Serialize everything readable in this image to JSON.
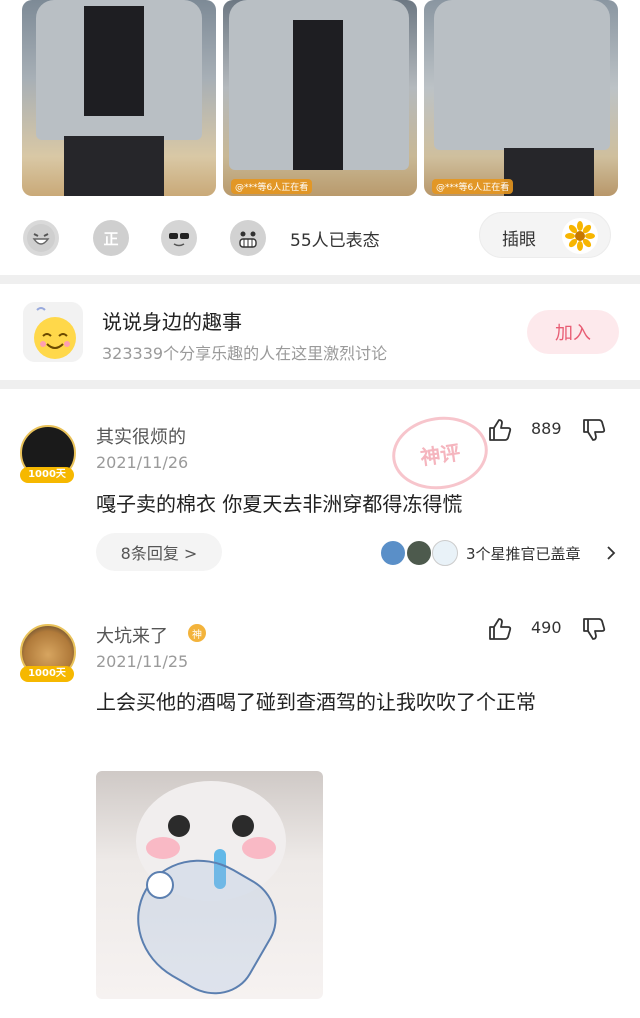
{
  "photos": {
    "items": [
      {
        "tag": ""
      },
      {
        "tag": "@***等6人正在看"
      },
      {
        "tag": "@***等6人正在看"
      }
    ]
  },
  "reactions": {
    "icons": [
      "laughing-face-icon",
      "zheng-badge-icon",
      "sunglasses-face-icon",
      "grinning-face-icon"
    ],
    "zheng_char": "正",
    "count_text": "55人已表态",
    "chayan_label": "插眼"
  },
  "group": {
    "title": "说说身边的趣事",
    "subtitle": "323339个分享乐趣的人在这里激烈讨论",
    "join_label": "加入"
  },
  "comments": [
    {
      "username": "其实很烦的",
      "date": "2021/11/26",
      "badge": "1000天",
      "likes": "889",
      "text": "嘎子卖的棉衣  你夏天去非洲穿都得冻得慌",
      "reply_label": "8条回复 >",
      "stars_text": "3个星推官已盖章",
      "stamp": "神评"
    },
    {
      "username": "大坑来了",
      "user_badge": "神",
      "date": "2021/11/25",
      "badge": "1000天",
      "likes": "490",
      "text": "上会买他的酒喝了碰到查酒驾的让我吹吹了个正常"
    }
  ],
  "colors": {
    "accent_pink": "#e85d74",
    "join_bg": "#fde9ec",
    "badge_gold": "#f6b800",
    "divider": "#efefef"
  }
}
